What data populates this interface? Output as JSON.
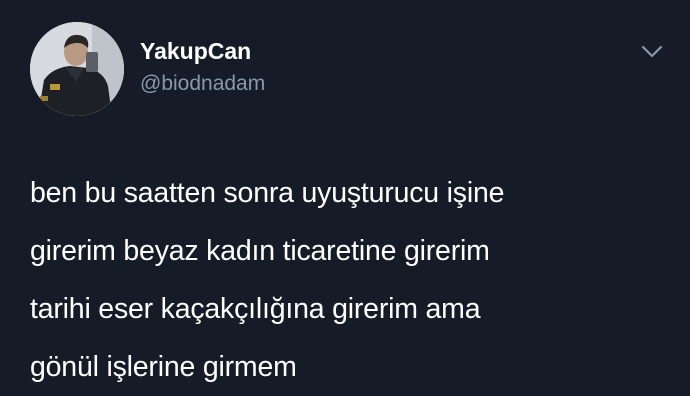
{
  "author": {
    "display_name": "YakupCan",
    "handle": "@biodnadam",
    "avatar_icon": "profile-photo"
  },
  "menu_icon": "chevron-down-icon",
  "tweet": {
    "lines": [
      "ben bu saatten sonra uyuşturucu işine",
      "girerim beyaz kadın ticaretine girerim",
      "tarihi eser kaçakçılığına girerim ama",
      "gönül işlerine girmem"
    ]
  },
  "colors": {
    "background": "#151c28",
    "primary_text": "#ffffff",
    "secondary_text": "#8b98a5"
  }
}
